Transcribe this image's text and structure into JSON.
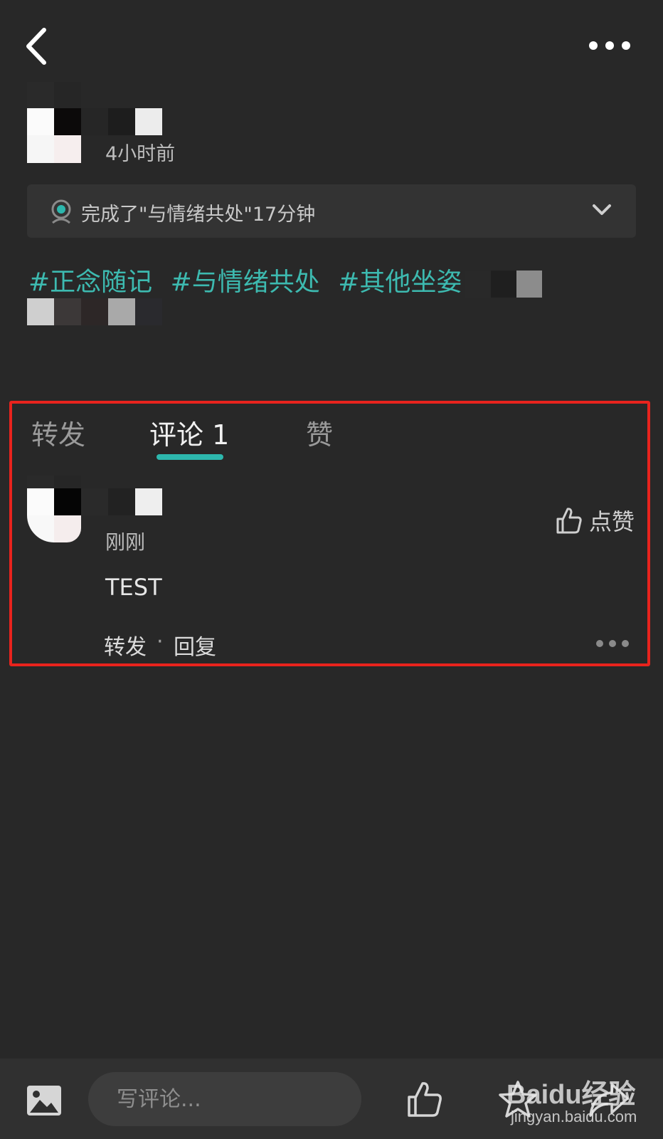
{
  "post": {
    "time": "4小时前",
    "activity": "完成了\"与情绪共处\"17分钟",
    "hashtags": [
      "#正念随记",
      "#与情绪共处",
      "#其他坐姿"
    ]
  },
  "tabs": {
    "repost": "转发",
    "comments": "评论 1",
    "likes": "赞"
  },
  "comment": {
    "time": "刚刚",
    "like_label": "点赞",
    "body": "TEST",
    "repost": "转发",
    "separator": "·",
    "reply": "回复"
  },
  "bottom_bar": {
    "input_placeholder": "写评论..."
  },
  "watermark": {
    "logo": "Baidu经验",
    "url": "jingyan.baidu.com"
  },
  "colors": {
    "background": "#282828",
    "accent": "#2db7ad",
    "hashtag": "#3dbab0",
    "highlight": "#e8231d"
  }
}
